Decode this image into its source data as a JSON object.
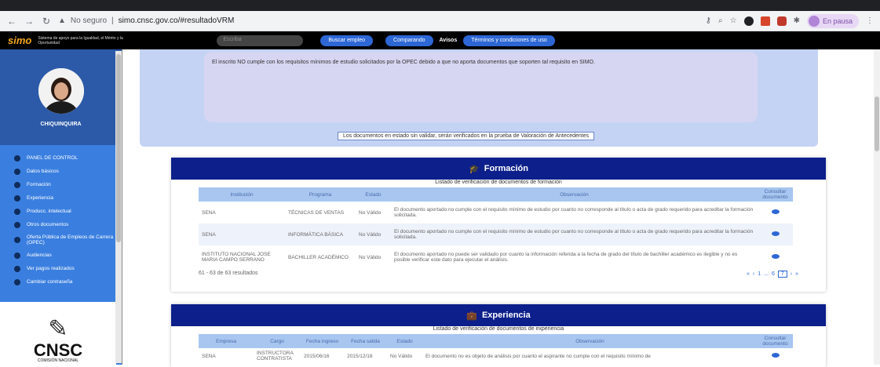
{
  "browser": {
    "security": "No seguro",
    "url": "simo.cnsc.gov.co/#resultadoVRM",
    "profile_status": "En pausa"
  },
  "appbar": {
    "logo": "simo",
    "tagline": "Sistema de apoyo para la Igualdad, el Mérito y la Oportunidad",
    "search_placeholder": "Escriba",
    "buttons": {
      "buscar": "Buscar empleo",
      "comparar": "Comparando",
      "avisos": "Avisos",
      "terminos": "Términos y condiciones de uso"
    }
  },
  "sidebar": {
    "user_name": "CHIQUINQUIRA",
    "items": [
      {
        "label": "PANEL DE CONTROL"
      },
      {
        "label": "Datos básicos"
      },
      {
        "label": "Formación"
      },
      {
        "label": "Experiencia"
      },
      {
        "label": "Producc. intelectual"
      },
      {
        "label": "Otros documentos"
      },
      {
        "label": "Oferta Pública de Empleos de Carrera (OPEC)"
      },
      {
        "label": "Audiencias"
      },
      {
        "label": "Ver pagos realizados"
      },
      {
        "label": "Cambiar contraseña"
      }
    ],
    "logo_title": "CNSC",
    "logo_sub": "COMISIÓN NACIONAL"
  },
  "observation": {
    "text": "El inscrito NO cumple con los requisitos mínimos de estudio solicitados por la OPEC debido a que no aporta documentos que soporten tal requisito en SIMO.",
    "note": "Los documentos en estado sin validar, serán verificados en la prueba de Valoración de Antecedentes"
  },
  "formacion": {
    "title": "Formación",
    "caption": "Listado de verificación de documentos de formación",
    "headers": [
      "Institución",
      "Programa",
      "Estado",
      "Observación",
      "Consultar documento"
    ],
    "rows": [
      {
        "institucion": "SENA",
        "programa": "TÉCNICAS DE VENTAS",
        "estado": "No Válido",
        "observacion": "El documento aportado no cumple con el requisito mínimo de estudio por cuanto no corresponde al título o acta de grado requerido para acreditar la formación solicitada."
      },
      {
        "institucion": "SENA",
        "programa": "INFORMÁTICA BÁSICA",
        "estado": "No Válido",
        "observacion": "El documento aportado no cumple con el requisito mínimo de estudio por cuanto no corresponde al título o acta de grado requerido para acreditar la formación solicitada."
      },
      {
        "institucion": "INSTITUTO NACIONAL JOSE MARIA CAMPO SERRANO",
        "programa": "BACHILLER ACADÉMICO",
        "estado": "No Válido",
        "observacion": "El documento aportado no puede ser validado por cuanto la información referida a la fecha de grado del título de bachiller académico es ilegible y no es posible verificar este dato para ejecutar el análisis."
      }
    ],
    "results": "61 - 63 de 63 resultados",
    "pager": {
      "first": "«",
      "prev": "‹",
      "p1": "1",
      "dots": "...",
      "p6": "6",
      "current": "7",
      "next": "›",
      "last": "»"
    }
  },
  "experiencia": {
    "title": "Experiencia",
    "caption": "Listado de verificación de documentos de experiencia",
    "headers": [
      "Empresa",
      "Cargo",
      "Fecha ingreso",
      "Fecha salida",
      "Estado",
      "Observación",
      "Consultar documento"
    ],
    "rows": [
      {
        "empresa": "SENA",
        "cargo": "INSTRUCTORA CONTRATISTA",
        "ingreso": "2015/06/16",
        "salida": "2015/12/18",
        "estado": "No Válido",
        "observacion": "El documento no es objeto de análisis por cuanto el aspirante no cumple con el requisito mínimo de"
      }
    ]
  }
}
